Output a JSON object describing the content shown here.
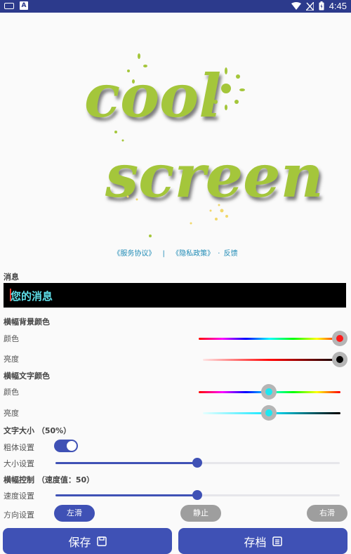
{
  "status": {
    "time": "4:45",
    "a_label": "A"
  },
  "banner": {
    "line1": "cool",
    "line2": "screen"
  },
  "links": {
    "terms": "《服务协议》",
    "sep1": "|",
    "privacy": "《隐私政策》",
    "sep2": "·",
    "feedback": "反馈"
  },
  "message": {
    "label": "消息",
    "text": "您的消息"
  },
  "bg_color": {
    "title": "横幅背景颜色",
    "hue_label": "颜色",
    "bright_label": "亮度"
  },
  "text_color": {
    "title": "横幅文字颜色",
    "hue_label": "颜色",
    "bright_label": "亮度"
  },
  "text_size": {
    "title": "文字大小 （50%）",
    "bold_label": "粗体设置",
    "size_label": "大小设置",
    "size_value": 0.5,
    "bold_on": true
  },
  "banner_ctrl": {
    "title": "横幅控制 （速度值：50）",
    "speed_label": "速度设置",
    "speed_value": 0.5,
    "direction_label": "方向设置",
    "directions": [
      "左滑",
      "静止",
      "右滑"
    ]
  },
  "actions": {
    "save": "保存",
    "archive": "存档"
  },
  "colors": {
    "accent": "#3f51b5",
    "status_bar": "#2c3a8c",
    "link": "#1f8bb6",
    "message_text": "#5fe0ea"
  }
}
